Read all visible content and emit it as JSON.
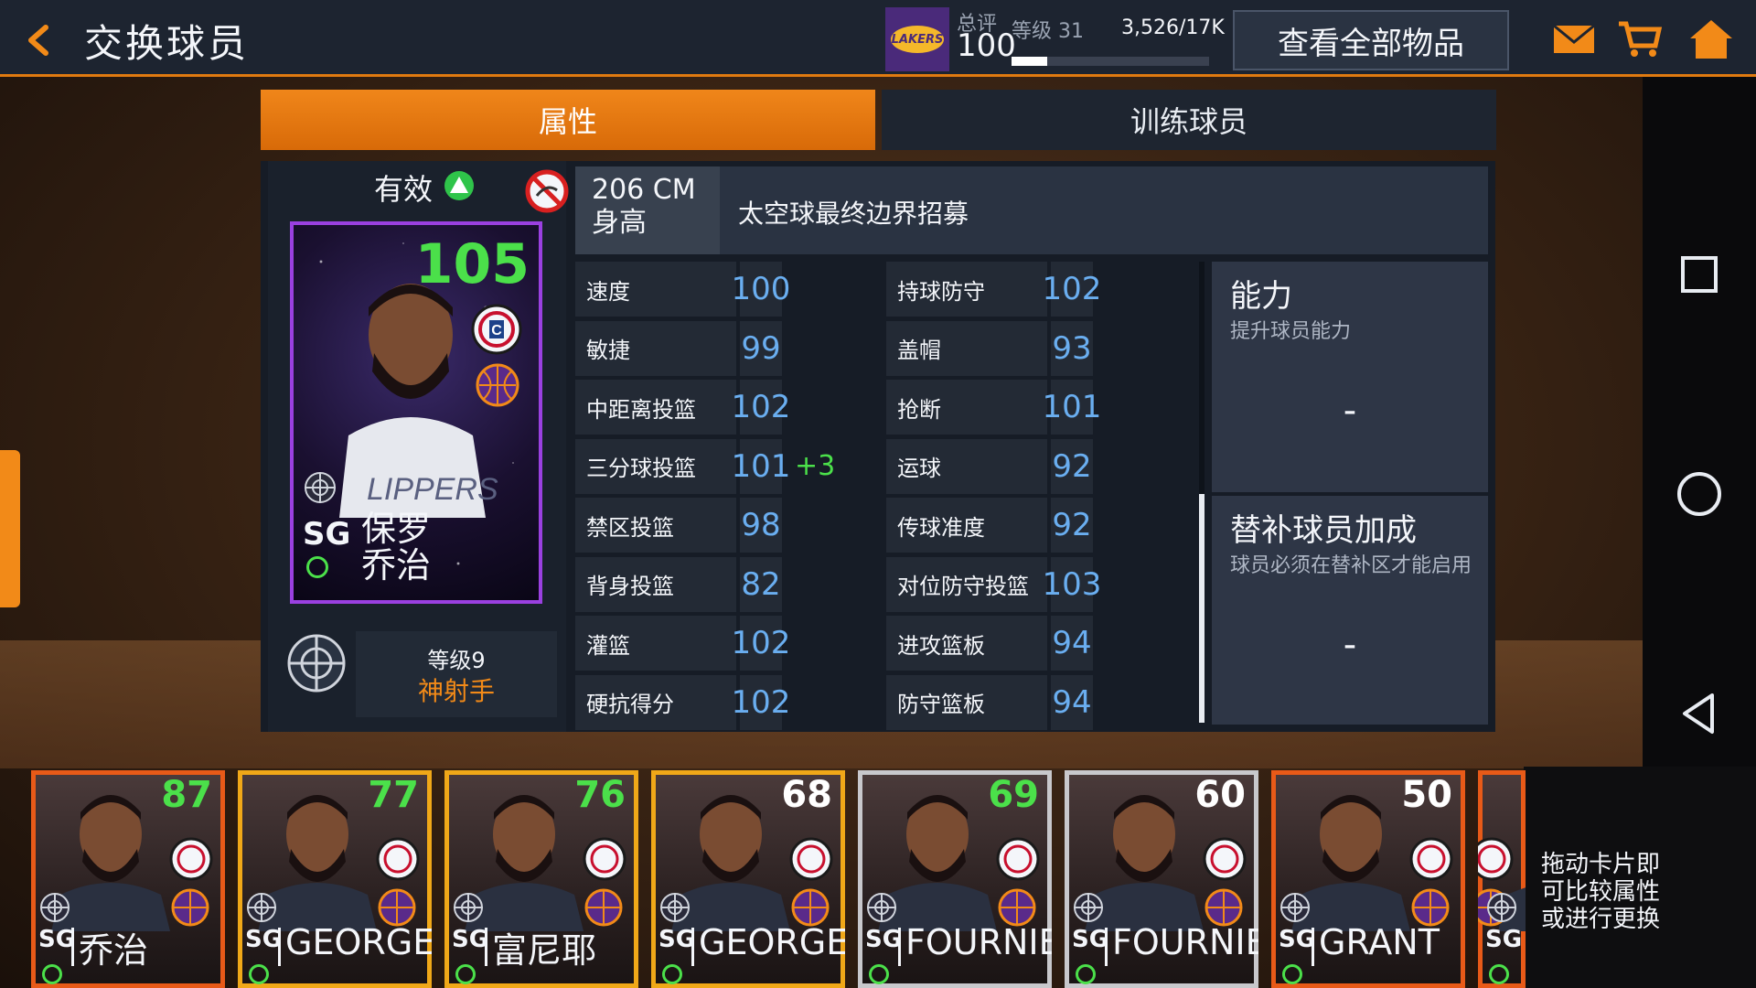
{
  "header": {
    "title": "交换球员",
    "team_logo_text": "LAKERS",
    "overall_label": "总评",
    "overall_value": "100",
    "level_label": "等级 31",
    "level_progress": 0.18,
    "xp_text": "3,526/17K",
    "view_all_label": "查看全部物品"
  },
  "tabs": [
    {
      "label": "属性",
      "active": true
    },
    {
      "label": "训练球员",
      "active": false
    }
  ],
  "player": {
    "status_label": "有效",
    "rating": "105",
    "position": "SG",
    "name_line1": "保罗",
    "name_line2": "乔治",
    "skill_level": "等级9",
    "skill_name": "神射手",
    "height_value": "206 CM",
    "height_label": "身高",
    "origin": "太空球最终边界招募"
  },
  "stats_left": [
    {
      "name": "速度",
      "value": "100"
    },
    {
      "name": "敏捷",
      "value": "99"
    },
    {
      "name": "中距离投篮",
      "value": "102"
    },
    {
      "name": "三分球投篮",
      "value": "101",
      "bonus": "+3"
    },
    {
      "name": "禁区投篮",
      "value": "98"
    },
    {
      "name": "背身投篮",
      "value": "82"
    },
    {
      "name": "灌篮",
      "value": "102"
    },
    {
      "name": "硬抗得分",
      "value": "102"
    }
  ],
  "stats_right": [
    {
      "name": "持球防守",
      "value": "102"
    },
    {
      "name": "盖帽",
      "value": "93"
    },
    {
      "name": "抢断",
      "value": "101"
    },
    {
      "name": "运球",
      "value": "92"
    },
    {
      "name": "传球准度",
      "value": "92"
    },
    {
      "name": "对位防守投篮",
      "value": "103"
    },
    {
      "name": "进攻篮板",
      "value": "94"
    },
    {
      "name": "防守篮板",
      "value": "94"
    }
  ],
  "ability": {
    "title": "能力",
    "subtitle": "提升球员能力",
    "value": "-"
  },
  "bench_bonus": {
    "title": "替补球员加成",
    "subtitle": "球员必须在替补区才能启用",
    "value": "-"
  },
  "strip": {
    "hint": "拖动卡片即可比较属性或进行更换",
    "cards": [
      {
        "rating": "87",
        "pos": "SG",
        "name": "乔治",
        "frame": "#e85a18",
        "rating_color": "#4be04a"
      },
      {
        "rating": "77",
        "pos": "SG",
        "name": "GEORGE",
        "frame": "#f0a818",
        "rating_color": "#4be04a"
      },
      {
        "rating": "76",
        "pos": "SG",
        "name": "富尼耶",
        "frame": "#f0a818",
        "rating_color": "#4be04a"
      },
      {
        "rating": "68",
        "pos": "SG",
        "name": "GEORGE",
        "frame": "#f0a818",
        "rating_color": "#ffffff"
      },
      {
        "rating": "69",
        "pos": "SG",
        "name": "FOURNIER",
        "frame": "#c8c8cc",
        "rating_color": "#4be04a"
      },
      {
        "rating": "60",
        "pos": "SG",
        "name": "FOURNIER",
        "frame": "#c8c8cc",
        "rating_color": "#ffffff"
      },
      {
        "rating": "50",
        "pos": "SG",
        "name": "GRANT",
        "frame": "#e85a18",
        "rating_color": "#ffffff"
      },
      {
        "rating": "",
        "pos": "SG",
        "name": "",
        "frame": "#e85a18",
        "rating_color": "#ffffff"
      }
    ]
  }
}
